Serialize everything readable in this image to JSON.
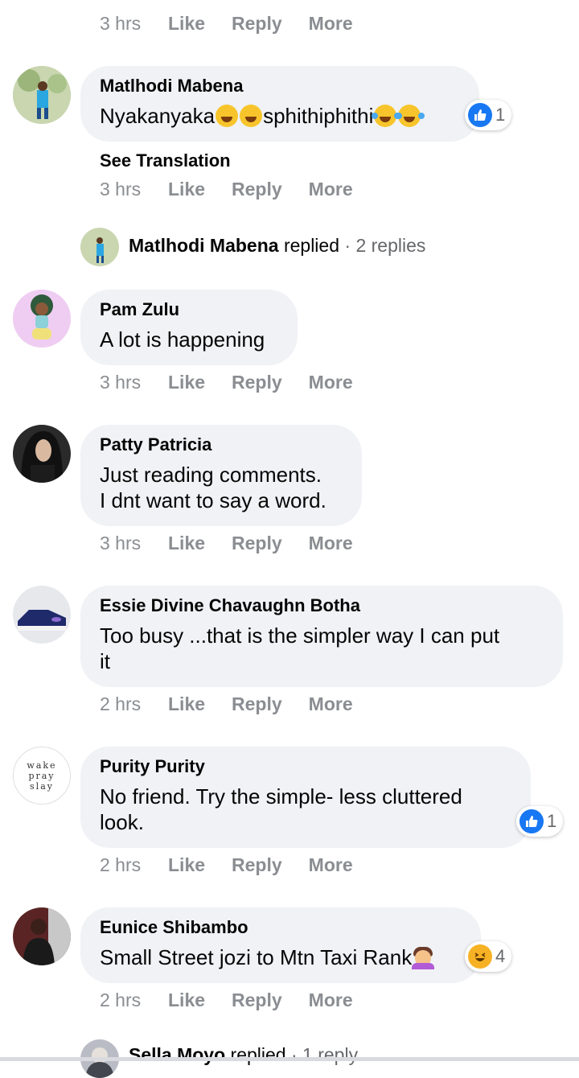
{
  "labels": {
    "like": "Like",
    "reply": "Reply",
    "more": "More",
    "see_translation": "See Translation"
  },
  "top_meta": {
    "time": "3 hrs"
  },
  "comments": [
    {
      "author": "Matlhodi Mabena",
      "text_parts": [
        "Nyakanyaka",
        "sphithiphithi"
      ],
      "time": "3 hrs",
      "reaction_count": "1"
    },
    {
      "author": "Pam Zulu",
      "text": "A lot is happening",
      "time": "3 hrs"
    },
    {
      "author": "Patty Patricia",
      "line1": "Just reading comments.",
      "line2": "I dnt want to say a word.",
      "time": "3 hrs"
    },
    {
      "author": "Essie Divine Chavaughn Botha",
      "line1": "Too busy ...that is the simpler way I can put",
      "line2": "it",
      "time": "2 hrs"
    },
    {
      "author": "Purity Purity",
      "line1": "No friend. Try the simple- less cluttered",
      "line2": "look.",
      "time": "2 hrs",
      "reaction_count": "1",
      "avatar_text": [
        "wake",
        "pray",
        "slay"
      ]
    },
    {
      "author": "Eunice Shibambo",
      "text": "Small Street jozi to Mtn Taxi Rank",
      "time": "2 hrs",
      "reaction_count": "4"
    }
  ],
  "replies": [
    {
      "name": "Matlhodi Mabena",
      "verb": "replied",
      "count": "· 2 replies"
    },
    {
      "name": "Sella Moyo",
      "verb": "replied",
      "count": "· 1 reply"
    }
  ],
  "colors": {
    "like_blue": "#1877f2",
    "bubble": "#f0f2f5",
    "meta_gray": "#8a8d91"
  }
}
